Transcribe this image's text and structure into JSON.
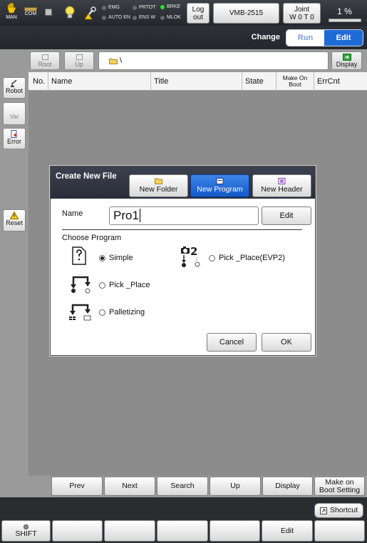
{
  "status": {
    "mode_icon_label": "MAN",
    "com_label": "COM",
    "indicators": [
      {
        "label": "EMG",
        "on": false
      },
      {
        "label": "AUTO EN",
        "on": false
      },
      {
        "label": "PRTOT",
        "on": false
      },
      {
        "label": "ENS W",
        "on": false
      },
      {
        "label": "BRKE",
        "on": true
      },
      {
        "label": "MLOK",
        "on": false
      }
    ],
    "logout_label": "Log out",
    "robot_model": "VMB-2515",
    "coord_label": "Joint",
    "coord_sub": "W 0 T 0",
    "speed": "1 %"
  },
  "mode_bar": {
    "change_label": "Change",
    "run_label": "Run",
    "edit_label": "Edit"
  },
  "side": {
    "robot_label": "Robot",
    "var_label": "Var",
    "error_label": "Error",
    "reset_label": "Reset"
  },
  "path": {
    "root_label": "Root",
    "up_label": "Up",
    "current_path": "\\",
    "display_label": "Display"
  },
  "table": {
    "columns": [
      "No.",
      "Name",
      "Title",
      "State",
      "Make On Boot",
      "ErrCnt"
    ]
  },
  "dialog": {
    "title": "Create New File",
    "tabs": [
      "New Folder",
      "New Program",
      "New Header"
    ],
    "name_label": "Name",
    "name_value": "Pro1",
    "edit_label": "Edit",
    "choose_label": "Choose Program",
    "options": [
      {
        "label": "Simple",
        "selected": true
      },
      {
        "label": "Pick _Place",
        "selected": false
      },
      {
        "label": "Palletizing",
        "selected": false
      },
      {
        "label": "Pick _Place(EVP2)",
        "selected": false
      }
    ],
    "cancel_label": "Cancel",
    "ok_label": "OK"
  },
  "bottom": {
    "row1": [
      "Prev",
      "Next",
      "Search",
      "Up",
      "Display",
      "Make on Boot Setting"
    ],
    "shortcut_label": "Shortcut",
    "row3": [
      "SHIFT",
      "",
      "",
      "",
      "",
      "Edit",
      ""
    ]
  }
}
